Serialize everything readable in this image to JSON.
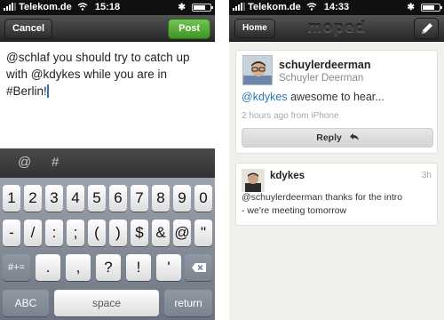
{
  "compose_screen": {
    "status_bar": {
      "carrier": "Telekom.de",
      "time": "15:18"
    },
    "nav": {
      "cancel_label": "Cancel",
      "post_label": "Post"
    },
    "compose_text": "@schlaf you should try to catch up with @kdykes while you are in #Berlin!",
    "accessory_keys": [
      "@",
      "#"
    ],
    "keyboard": {
      "row1": [
        "1",
        "2",
        "3",
        "4",
        "5",
        "6",
        "7",
        "8",
        "9",
        "0"
      ],
      "row2": [
        "-",
        "/",
        ":",
        ";",
        "(",
        ")",
        "$",
        "&",
        "@",
        "\""
      ],
      "row3_mode": "#+=",
      "row3": [
        ".",
        ",",
        "?",
        "!",
        "'"
      ],
      "abc": "ABC",
      "space": "space",
      "return": "return"
    }
  },
  "timeline_screen": {
    "status_bar": {
      "carrier": "Telekom.de",
      "time": "14:33"
    },
    "nav": {
      "home_label": "Home",
      "app_name": "moped"
    },
    "post": {
      "username": "schuylerdeerman",
      "full_name": "Schuyler Deerman",
      "mention": "@kdykes",
      "text": "awesome to hear...",
      "meta": "2 hours ago from iPhone",
      "reply_label": "Reply"
    },
    "second_post": {
      "username": "kdykes",
      "time": "3h",
      "text_line1": "@schuylerdeerman thanks for the intro",
      "text_line2": "- we're meeting tomorrow"
    }
  },
  "colors": {
    "post_button": "#4caf3a",
    "mention": "#2a7ab0",
    "caret": "#2a6fd3"
  }
}
